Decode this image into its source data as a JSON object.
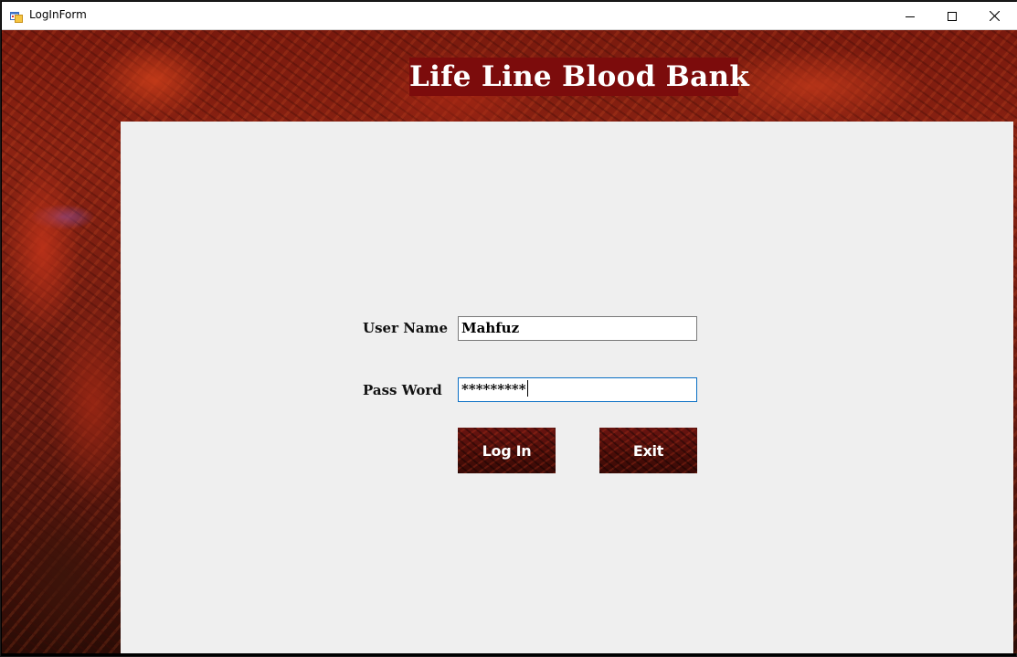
{
  "window": {
    "title": "LogInForm"
  },
  "header": {
    "title": "Life Line Blood Bank"
  },
  "form": {
    "user_label": "User Name",
    "user_value": "Mahfuz",
    "pass_label": "Pass Word",
    "pass_value": "*********",
    "login_label": "Log In",
    "exit_label": "Exit"
  },
  "icons": {
    "app": "app-form-icon",
    "minimize": "minimize-icon",
    "maximize": "maximize-icon",
    "close": "close-icon"
  },
  "colors": {
    "title_bg": "#7c0c0c",
    "panel_bg": "#efefef",
    "focus_border": "#0a6fc4"
  }
}
